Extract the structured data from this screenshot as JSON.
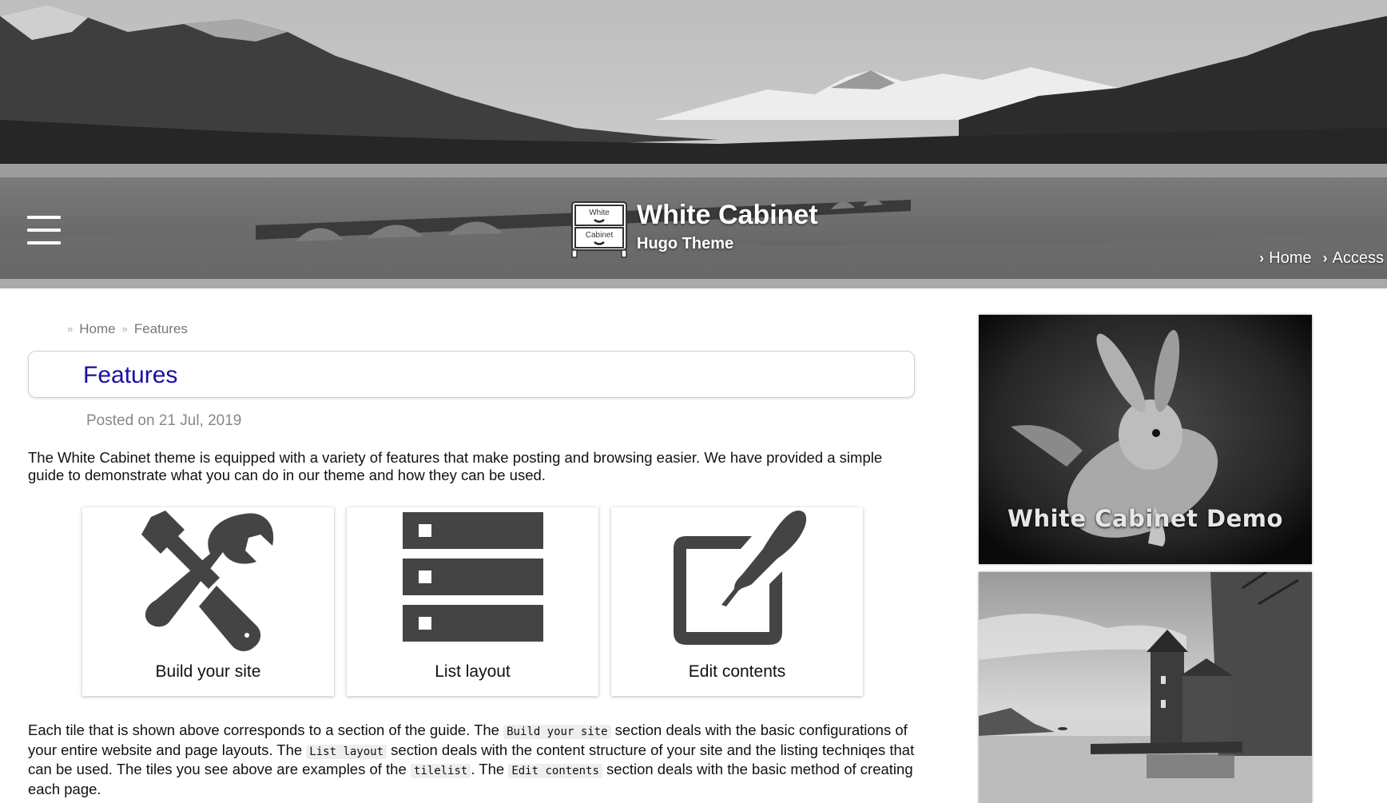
{
  "header": {
    "site_title": "White Cabinet",
    "site_subtitle": "Hugo Theme",
    "logo_top_text": "White",
    "logo_bottom_text": "Cabinet",
    "nav": [
      {
        "label": "Home",
        "icon": "chevron-right-icon"
      },
      {
        "label": "Access",
        "icon": "chevron-right-icon"
      }
    ]
  },
  "breadcrumb": {
    "separator": "»",
    "items": [
      "Home",
      "Features"
    ]
  },
  "page": {
    "title": "Features",
    "posted": "Posted on 21 Jul, 2019",
    "intro": "The White Cabinet theme is equipped with a variety of features that make posting and browsing easier. We have provided a simple guide to demonstrate what you can do in our theme and how they can be used.",
    "outro": {
      "t1": "Each tile that is shown above corresponds to a section of the guide. The ",
      "c1": "Build your site",
      "t2": " section deals with the basic configurations of your entire website and page layouts. The ",
      "c2": "List layout",
      "t3": " section deals with the content structure of your site and the listing techniqes that can be used. The tiles you see above are examples of the ",
      "c3": "tilelist",
      "t4": ". The ",
      "c4": "Edit contents",
      "t5": " section deals with the basic method of creating each page."
    }
  },
  "tiles": [
    {
      "label": "Build your site",
      "icon": "tools-icon"
    },
    {
      "label": "List layout",
      "icon": "list-icon"
    },
    {
      "label": "Edit contents",
      "icon": "edit-icon"
    }
  ],
  "sidebar": {
    "demo_image_text": "White Cabinet Demo",
    "second_image": "castle-lake-image"
  },
  "colors": {
    "title": "#1a0ea6",
    "icon": "#444444",
    "header_bar": "#a9a9a9"
  }
}
